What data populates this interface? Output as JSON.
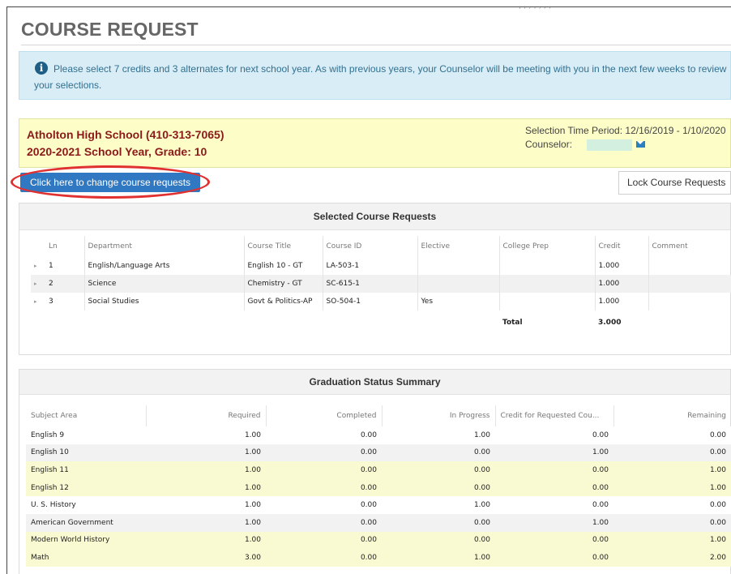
{
  "page": {
    "title": "COURSE REQUEST",
    "top_cut_text": ", ,  , , , , ,"
  },
  "info": {
    "message": "Please select 7 credits and 3 alternates for next school year. As with previous years, your Counselor will be meeting with you in the next few weeks to review your selections."
  },
  "school": {
    "name": "Atholton High School (410-313-7065)",
    "year_grade": "2020-2021 School Year, Grade: 10",
    "period": "Selection Time Period: 12/16/2019 - 1/10/2020",
    "counselor_label": "Counselor:"
  },
  "buttons": {
    "change": "Click here to change course requests",
    "lock": "Lock Course Requests"
  },
  "selected": {
    "title": "Selected Course Requests",
    "columns": [
      "Ln",
      "Department",
      "Course Title",
      "Course ID",
      "Elective",
      "College Prep",
      "Credit",
      "Comment"
    ],
    "rows": [
      {
        "ln": "1",
        "department": "English/Language Arts",
        "course_title": "English 10 - GT",
        "course_id": "LA-503-1",
        "elective": "",
        "college_prep": "",
        "credit": "1.000",
        "comment": ""
      },
      {
        "ln": "2",
        "department": "Science",
        "course_title": "Chemistry - GT",
        "course_id": "SC-615-1",
        "elective": "",
        "college_prep": "",
        "credit": "1.000",
        "comment": ""
      },
      {
        "ln": "3",
        "department": "Social Studies",
        "course_title": "Govt & Politics-AP",
        "course_id": "SO-504-1",
        "elective": "Yes",
        "college_prep": "",
        "credit": "1.000",
        "comment": ""
      }
    ],
    "total_label": "Total",
    "total_value": "3.000"
  },
  "graduation": {
    "title": "Graduation Status Summary",
    "columns": [
      "Subject Area",
      "Required",
      "Completed",
      "In Progress",
      "Credit for Requested Cou...",
      "Remaining"
    ],
    "rows": [
      {
        "subject": "English 9",
        "required": "1.00",
        "completed": "0.00",
        "in_progress": "1.00",
        "requested": "0.00",
        "remaining": "0.00",
        "style": "norm"
      },
      {
        "subject": "English 10",
        "required": "1.00",
        "completed": "0.00",
        "in_progress": "0.00",
        "requested": "1.00",
        "remaining": "0.00",
        "style": "alt"
      },
      {
        "subject": "English 11",
        "required": "1.00",
        "completed": "0.00",
        "in_progress": "0.00",
        "requested": "0.00",
        "remaining": "1.00",
        "style": "hl"
      },
      {
        "subject": "English 12",
        "required": "1.00",
        "completed": "0.00",
        "in_progress": "0.00",
        "requested": "0.00",
        "remaining": "1.00",
        "style": "hl"
      },
      {
        "subject": "U. S. History",
        "required": "1.00",
        "completed": "0.00",
        "in_progress": "1.00",
        "requested": "0.00",
        "remaining": "0.00",
        "style": "norm"
      },
      {
        "subject": "American Government",
        "required": "1.00",
        "completed": "0.00",
        "in_progress": "0.00",
        "requested": "1.00",
        "remaining": "0.00",
        "style": "alt"
      },
      {
        "subject": "Modern World History",
        "required": "1.00",
        "completed": "0.00",
        "in_progress": "0.00",
        "requested": "0.00",
        "remaining": "1.00",
        "style": "hl"
      },
      {
        "subject": "Math",
        "required": "3.00",
        "completed": "0.00",
        "in_progress": "1.00",
        "requested": "0.00",
        "remaining": "2.00",
        "style": "hl"
      }
    ]
  },
  "colors": {
    "info_bg": "#d9edf7",
    "school_bg": "#fdfdc8",
    "school_text": "#8b1a1a",
    "button_blue": "#3079c2",
    "highlight_ring": "#e03030",
    "row_highlight": "#fafad2"
  },
  "icons": {
    "info": "info-circle-icon",
    "mail": "envelope-icon",
    "expand": "caret-right-icon"
  }
}
